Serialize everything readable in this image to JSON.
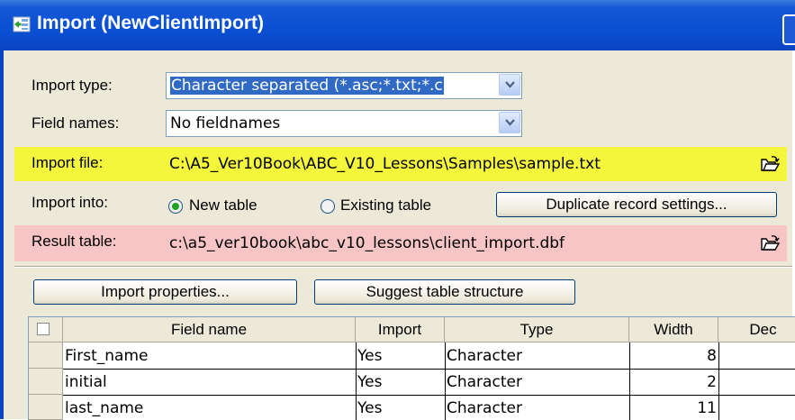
{
  "window": {
    "title": "Import (NewClientImport)"
  },
  "form": {
    "import_type_label": "Import type:",
    "import_type_value": "Character separated (*.asc;*.txt;*.c",
    "field_names_label": "Field names:",
    "field_names_value": "No fieldnames",
    "import_file_label": "Import file:",
    "import_file_value": "C:\\A5_Ver10Book\\ABC_V10_Lessons\\Samples\\sample.txt",
    "import_into_label": "Import into:",
    "radio_new_label": "New table",
    "radio_existing_label": "Existing table",
    "import_into_selected": "New table",
    "duplicate_button": "Duplicate record settings...",
    "result_table_label": "Result table:",
    "result_table_value": "c:\\a5_ver10book\\abc_v10_lessons\\client_import.dbf"
  },
  "buttons": {
    "import_properties": "Import properties...",
    "suggest_structure": "Suggest table structure"
  },
  "grid": {
    "columns": [
      "Field name",
      "Import",
      "Type",
      "Width",
      "Dec"
    ],
    "rows": [
      {
        "name": "First_name",
        "import": "Yes",
        "type": "Character",
        "width": "8",
        "dec": ""
      },
      {
        "name": "initial",
        "import": "Yes",
        "type": "Character",
        "width": "2",
        "dec": ""
      },
      {
        "name": "last_name",
        "import": "Yes",
        "type": "Character",
        "width": "11",
        "dec": ""
      }
    ]
  },
  "colors": {
    "titlebar": "#0a4fd3",
    "highlight_import_file": "#f3f63b",
    "highlight_result_table": "#f7c5c5",
    "dialog_bg": "#ece9d8"
  }
}
